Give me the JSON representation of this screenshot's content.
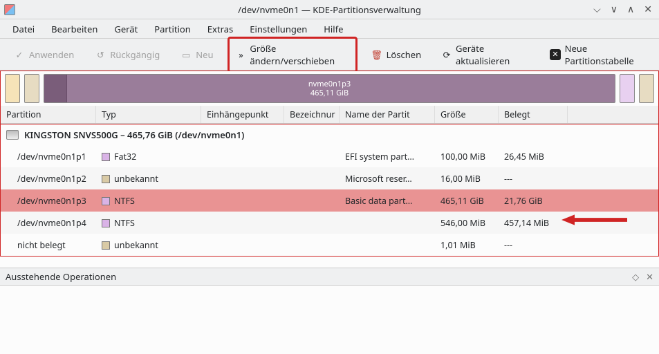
{
  "window": {
    "title": "/dev/nvme0n1 — KDE-Partitionsverwaltung"
  },
  "menu": {
    "file": "Datei",
    "edit": "Bearbeiten",
    "device": "Gerät",
    "partition": "Partition",
    "extras": "Extras",
    "settings": "Einstellungen",
    "help": "Hilfe"
  },
  "toolbar": {
    "apply": "Anwenden",
    "undo": "Rückgängig",
    "new": "Neu",
    "resize": "Größe ändern/verschieben",
    "delete": "Löschen",
    "refresh": "Geräte aktualisieren",
    "newtable": "Neue Partitionstabelle"
  },
  "diskbar": {
    "main_name": "nvme0n1p3",
    "main_size": "465,11 GiB"
  },
  "columns": {
    "partition": "Partition",
    "type": "Typ",
    "mount": "Einhängepunkt",
    "label": "Bezeichnur",
    "name": "Name der Partit",
    "size": "Größe",
    "used": "Belegt"
  },
  "device": {
    "line": "KINGSTON SNVS500G – 465,76 GiB (/dev/nvme0n1)"
  },
  "rows": [
    {
      "partition": "/dev/nvme0n1p1",
      "type": "Fat32",
      "swatch": "sw-fat32",
      "name": "EFI system part…",
      "size": "100,00 MiB",
      "used": "26,45 MiB",
      "selected": false
    },
    {
      "partition": "/dev/nvme0n1p2",
      "type": "unbekannt",
      "swatch": "sw-unk",
      "name": "Microsoft reser…",
      "size": "16,00 MiB",
      "used": "---",
      "selected": false
    },
    {
      "partition": "/dev/nvme0n1p3",
      "type": "NTFS",
      "swatch": "sw-ntfs",
      "name": "Basic data part…",
      "size": "465,11 GiB",
      "used": "21,76 GiB",
      "selected": true
    },
    {
      "partition": "/dev/nvme0n1p4",
      "type": "NTFS",
      "swatch": "sw-ntfs",
      "name": "",
      "size": "546,00 MiB",
      "used": "457,14 MiB",
      "selected": false
    },
    {
      "partition": "nicht belegt",
      "type": "unbekannt",
      "swatch": "sw-unk",
      "name": "",
      "size": "1,01 MiB",
      "used": "---",
      "selected": false
    }
  ],
  "pending": {
    "title": "Ausstehende Operationen"
  }
}
